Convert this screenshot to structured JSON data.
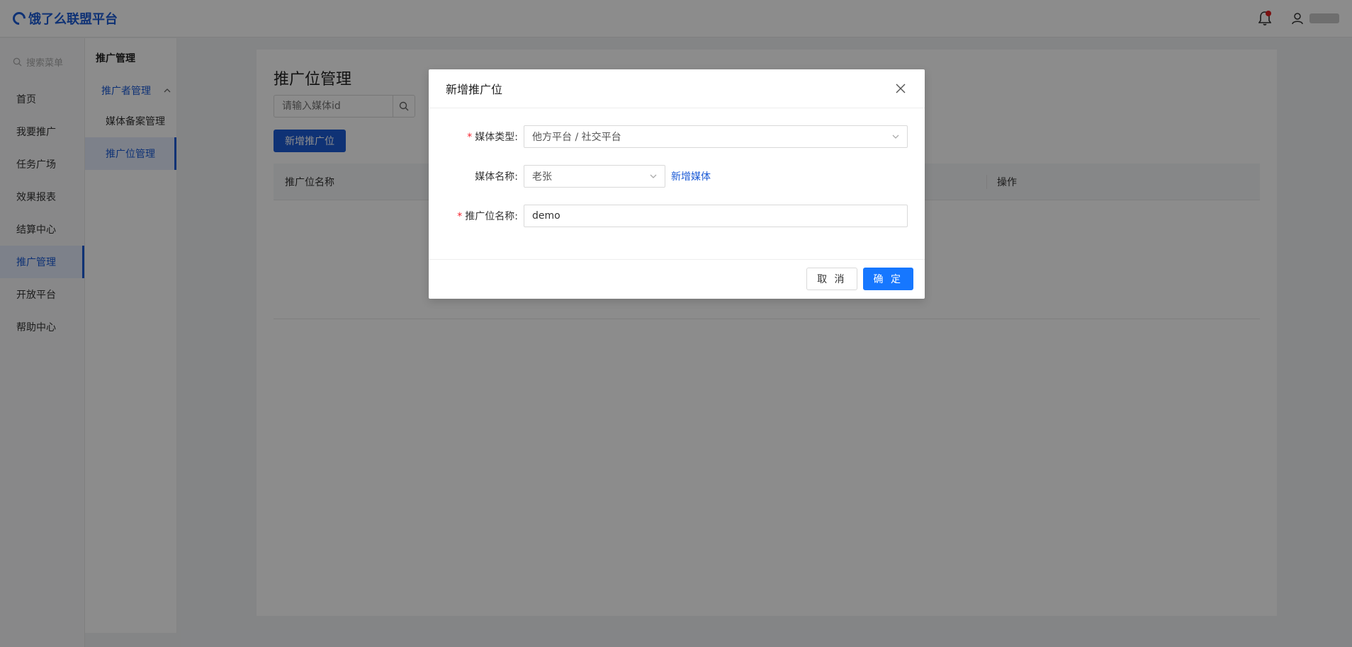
{
  "header": {
    "logo_text": "饿了么联盟平台",
    "notification_count_visible": true
  },
  "sidebar": {
    "search_placeholder": "搜索菜单",
    "items": [
      {
        "label": "首页"
      },
      {
        "label": "我要推广"
      },
      {
        "label": "任务广场"
      },
      {
        "label": "效果报表"
      },
      {
        "label": "结算中心"
      },
      {
        "label": "推广管理"
      },
      {
        "label": "开放平台"
      },
      {
        "label": "帮助中心"
      }
    ],
    "active_index": 5
  },
  "subnav": {
    "title": "推广管理",
    "group_label": "推广者管理",
    "items": [
      {
        "label": "媒体备案管理"
      },
      {
        "label": "推广位管理"
      }
    ],
    "active_index": 1
  },
  "main": {
    "title": "推广位管理",
    "search_placeholder": "请输入媒体id",
    "add_button_label": "新增推广位",
    "table": {
      "columns": [
        "推广位名称",
        "操作"
      ]
    }
  },
  "modal": {
    "title": "新增推广位",
    "fields": {
      "media_type": {
        "label": "媒体类型:",
        "required": true,
        "value": "他方平台 / 社交平台"
      },
      "media_name": {
        "label": "媒体名称:",
        "required": false,
        "value": "老张",
        "link": "新增媒体"
      },
      "slot_name": {
        "label": "推广位名称:",
        "required": true,
        "value": "demo"
      }
    },
    "cancel_label": "取 消",
    "confirm_label": "确 定"
  },
  "colors": {
    "accent": "#1c5bd6",
    "primary_button": "#1677ff",
    "required_star": "#f5222d",
    "notification_dot": "#e02020"
  }
}
